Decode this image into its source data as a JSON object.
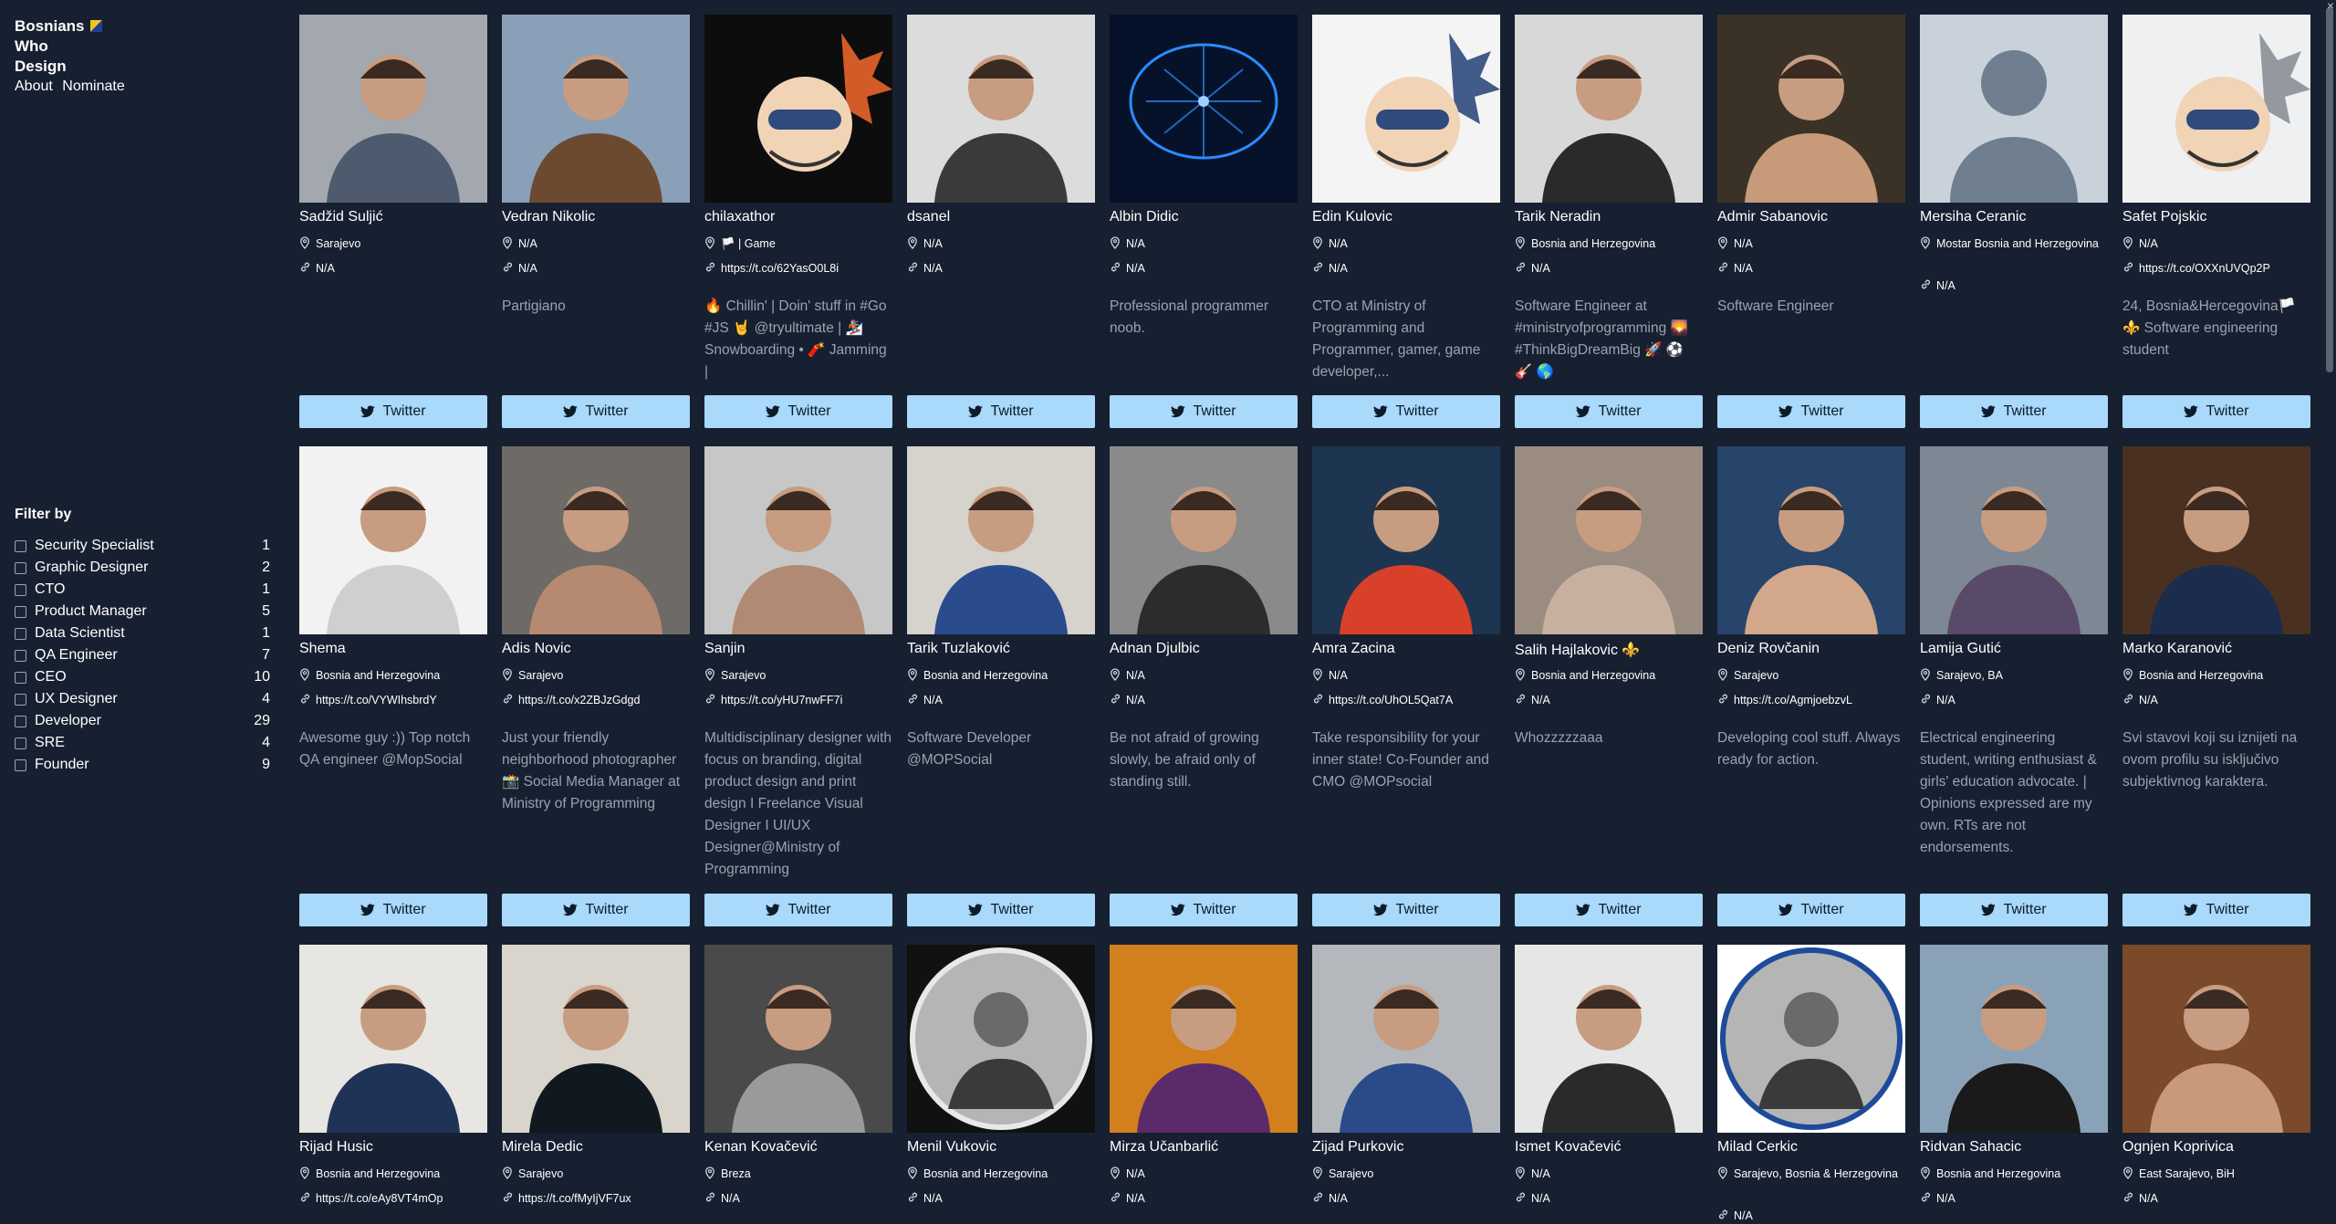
{
  "brand": {
    "line1": "Bosnians",
    "line2": "Who",
    "line3": "Design"
  },
  "nav": {
    "about": "About",
    "nominate": "Nominate"
  },
  "filter": {
    "title": "Filter by",
    "items": [
      {
        "label": "Security Specialist",
        "count": "1"
      },
      {
        "label": "Graphic Designer",
        "count": "2"
      },
      {
        "label": "CTO",
        "count": "1"
      },
      {
        "label": "Product Manager",
        "count": "5"
      },
      {
        "label": "Data Scientist",
        "count": "1"
      },
      {
        "label": "QA Engineer",
        "count": "7"
      },
      {
        "label": "CEO",
        "count": "10"
      },
      {
        "label": "UX Designer",
        "count": "4"
      },
      {
        "label": "Developer",
        "count": "29"
      },
      {
        "label": "SRE",
        "count": "4"
      },
      {
        "label": "Founder",
        "count": "9"
      }
    ]
  },
  "button_label": "Twitter",
  "colors": {
    "background": "#172030",
    "button": "#a9d9fb",
    "muted_text": "#9aa3b0"
  },
  "icons": {
    "location": "map-pin-icon",
    "link": "link-icon",
    "twitter": "twitter-bird-icon"
  },
  "people": [
    {
      "name": "Sadžid Suljić",
      "location": "Sarajevo",
      "link": "N/A",
      "bio": "",
      "photo": {
        "bg": "#a3a8ae",
        "fg": "#4e5a6e",
        "style": "person"
      }
    },
    {
      "name": "Vedran Nikolic",
      "location": "N/A",
      "link": "N/A",
      "bio": "Partigiano",
      "photo": {
        "bg": "#8aa0b8",
        "fg": "#6b4a30",
        "style": "person"
      }
    },
    {
      "name": "chilaxathor",
      "location": "🏳️ | Game",
      "link": "https://t.co/62YasO0L8i",
      "bio": "🔥 Chillin' | Doin' stuff in #Go #JS 🤘 @tryultimate | 🏂 Snowboarding • 🧨 Jamming |",
      "photo": {
        "bg": "#0d0d0d",
        "fg": "#e8642a",
        "style": "cartoon"
      }
    },
    {
      "name": "dsanel",
      "location": "N/A",
      "link": "N/A",
      "bio": "",
      "photo": {
        "bg": "#dcdcdc",
        "fg": "#3a3a3a",
        "style": "person"
      }
    },
    {
      "name": "Albin Didic",
      "location": "N/A",
      "link": "N/A",
      "bio": "Professional programmer noob.",
      "photo": {
        "bg": "#06122a",
        "fg": "#2a8cff",
        "style": "brain"
      }
    },
    {
      "name": "Edin Kulovic",
      "location": "N/A",
      "link": "N/A",
      "bio": "CTO at Ministry of Programming and Programmer, gamer, game developer,...",
      "photo": {
        "bg": "#f4f4f4",
        "fg": "#2f4a7c",
        "style": "cartoon"
      }
    },
    {
      "name": "Tarik Neradin",
      "location": "Bosnia and Herzegovina",
      "link": "N/A",
      "bio": "Software Engineer at #ministryofprogramming 🌄 #ThinkBigDreamBig 🚀 ⚽ 🎸 🌎",
      "photo": {
        "bg": "#d8d8d8",
        "fg": "#2a2a2a",
        "style": "person"
      }
    },
    {
      "name": "Admir Sabanovic",
      "location": "N/A",
      "link": "N/A",
      "bio": "Software Engineer",
      "photo": {
        "bg": "#3a3226",
        "fg": "#c79a7a",
        "style": "person"
      }
    },
    {
      "name": "Mersiha Ceranic",
      "location": "Mostar Bosnia and Herzegovina",
      "link": "N/A",
      "bio": "",
      "photo": {
        "bg": "#c9d2da",
        "fg": "#6f7f90",
        "style": "placeholder"
      }
    },
    {
      "name": "Safet Pojskic",
      "location": "N/A",
      "link": "https://t.co/OXXnUVQp2P",
      "bio": "24, Bosnia&Hercegovina🏳️ ⚜️ Software engineering student",
      "photo": {
        "bg": "#eef0f2",
        "fg": "#8a8f96",
        "style": "cartoon"
      }
    },
    {
      "name": "Shema",
      "location": "Bosnia and Herzegovina",
      "link": "https://t.co/VYWIhsbrdY",
      "bio": "Awesome guy :)) Top notch QA engineer @MopSocial",
      "photo": {
        "bg": "#f2f2f2",
        "fg": "#cfcfcf",
        "style": "person"
      }
    },
    {
      "name": "Adis Novic",
      "location": "Sarajevo",
      "link": "https://t.co/x2ZBJzGdgd",
      "bio": "Just your friendly neighborhood photographer 📸 Social Media Manager at Ministry of Programming",
      "photo": {
        "bg": "#6e6a66",
        "fg": "#b58a70",
        "style": "person"
      }
    },
    {
      "name": "Sanjin",
      "location": "Sarajevo",
      "link": "https://t.co/yHU7nwFF7i",
      "bio": "Multidisciplinary designer with focus on branding, digital product design and print design I Freelance Visual Designer I UI/UX Designer@Ministry of Programming",
      "photo": {
        "bg": "#c7c7c7",
        "fg": "#b08a72",
        "style": "person"
      }
    },
    {
      "name": "Tarik Tuzlaković",
      "location": "Bosnia and Herzegovina",
      "link": "N/A",
      "bio": "Software Developer @MOPSocial",
      "photo": {
        "bg": "#d6d2cc",
        "fg": "#2a4c8c",
        "style": "person"
      }
    },
    {
      "name": "Adnan Djulbic",
      "location": "N/A",
      "link": "N/A",
      "bio": "Be not afraid of growing slowly, be afraid only of standing still.",
      "photo": {
        "bg": "#8a8a8a",
        "fg": "#2c2c2c",
        "style": "person"
      }
    },
    {
      "name": "Amra Zacina",
      "location": "N/A",
      "link": "https://t.co/UhOL5Qat7A",
      "bio": "Take responsibility for your inner state! Co-Founder and CMO @MOPsocial",
      "photo": {
        "bg": "#1d3550",
        "fg": "#d9402a",
        "style": "person"
      }
    },
    {
      "name": "Salih Hajlakovic ⚜️",
      "location": "Bosnia and Herzegovina",
      "link": "N/A",
      "bio": "Whozzzzzaaa",
      "photo": {
        "bg": "#9a8c80",
        "fg": "#c8b0a0",
        "style": "person"
      }
    },
    {
      "name": "Deniz Rovčanin",
      "location": "Sarajevo",
      "link": "https://t.co/AgmjoebzvL",
      "bio": "Developing cool stuff. Always ready for action.",
      "photo": {
        "bg": "#27446a",
        "fg": "#d3a88a",
        "style": "person"
      }
    },
    {
      "name": "Lamija Gutić",
      "location": "Sarajevo, BA",
      "link": "N/A",
      "bio": "Electrical engineering student, writing enthusiast & girls' education advocate. | Opinions expressed are my own. RTs are not endorsements.",
      "photo": {
        "bg": "#7d8894",
        "fg": "#5a4a6a",
        "style": "person"
      }
    },
    {
      "name": "Marko Karanović",
      "location": "Bosnia and Herzegovina",
      "link": "N/A",
      "bio": "Svi stavovi koji su iznijeti na ovom profilu su isključivo subjektivnog karaktera.",
      "photo": {
        "bg": "#4a3020",
        "fg": "#1c2c4c",
        "style": "person"
      }
    },
    {
      "name": "Rijad Husic",
      "location": "Bosnia and Herzegovina",
      "link": "https://t.co/eAy8VT4mOp",
      "bio": "",
      "photo": {
        "bg": "#e8e6e2",
        "fg": "#1e3356",
        "style": "person"
      }
    },
    {
      "name": "Mirela Dedic",
      "location": "Sarajevo",
      "link": "https://t.co/fMyIjVF7ux",
      "bio": "",
      "photo": {
        "bg": "#d9d4cc",
        "fg": "#101820",
        "style": "person"
      }
    },
    {
      "name": "Kenan Kovačević",
      "location": "Breza",
      "link": "N/A",
      "bio": "",
      "photo": {
        "bg": "#4a4a4a",
        "fg": "#9a9a9a",
        "style": "person"
      }
    },
    {
      "name": "Menil Vukovic",
      "location": "Bosnia and Herzegovina",
      "link": "N/A",
      "bio": "",
      "photo": {
        "bg": "#111111",
        "fg": "#e8e8e8",
        "style": "circle"
      }
    },
    {
      "name": "Mirza Učanbarlić",
      "location": "N/A",
      "link": "N/A",
      "bio": "",
      "photo": {
        "bg": "#d2801e",
        "fg": "#5a2a6a",
        "style": "person"
      }
    },
    {
      "name": "Zijad Purkovic",
      "location": "Sarajevo",
      "link": "N/A",
      "bio": "",
      "photo": {
        "bg": "#b4b8bc",
        "fg": "#2a4a8a",
        "style": "person"
      }
    },
    {
      "name": "Ismet Kovačević",
      "location": "N/A",
      "link": "N/A",
      "bio": "",
      "photo": {
        "bg": "#e6e6e6",
        "fg": "#2a2a2a",
        "style": "person"
      }
    },
    {
      "name": "Milad Cerkic",
      "location": "Sarajevo, Bosnia & Herzegovina",
      "link": "N/A",
      "bio": "",
      "photo": {
        "bg": "#ffffff",
        "fg": "#1e4a9a",
        "style": "circle"
      }
    },
    {
      "name": "Ridvan Sahacic",
      "location": "Bosnia and Herzegovina",
      "link": "N/A",
      "bio": "",
      "photo": {
        "bg": "#8aa2b8",
        "fg": "#1a1a1a",
        "style": "person"
      }
    },
    {
      "name": "Ognjen Koprivica",
      "location": "East Sarajevo, BiH",
      "link": "N/A",
      "bio": "",
      "photo": {
        "bg": "#7a4a2a",
        "fg": "#c89a7a",
        "style": "person"
      }
    }
  ]
}
